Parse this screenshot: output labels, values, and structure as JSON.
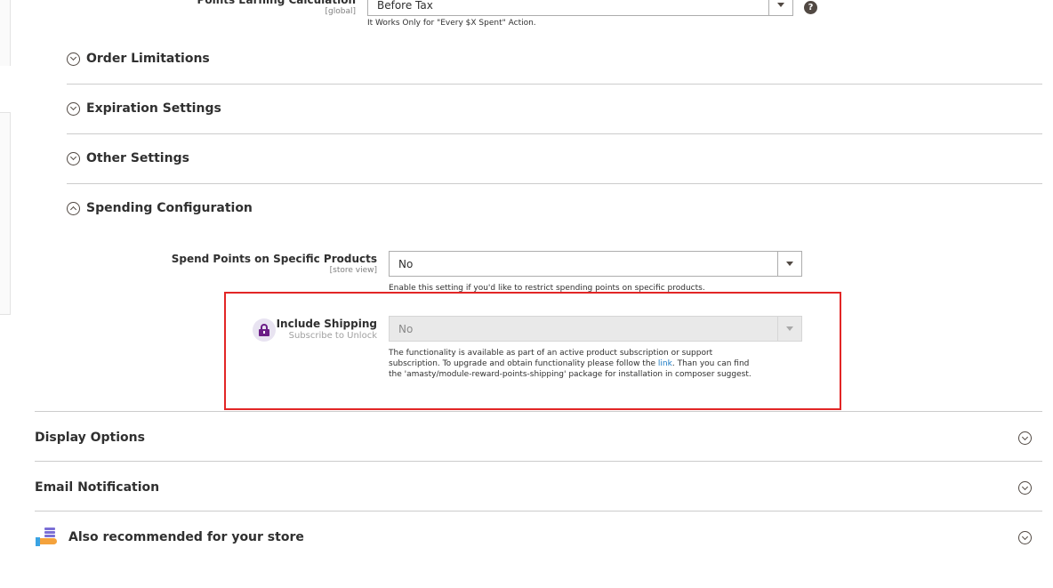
{
  "top_field": {
    "label": "Points Earning Calculation",
    "scope": "[global]",
    "value": "Before Tax",
    "note": "It Works Only for \"Every $X Spent\" Action.",
    "help_glyph": "?"
  },
  "subsections": {
    "order_limitations": "Order Limitations",
    "expiration_settings": "Expiration Settings",
    "other_settings": "Other Settings",
    "spending_configuration": "Spending Configuration"
  },
  "spend_specific": {
    "label": "Spend Points on Specific Products",
    "scope": "[store view]",
    "value": "No",
    "note": "Enable this setting if you'd like to restrict spending points on specific products."
  },
  "include_shipping": {
    "label": "Include Shipping",
    "sublabel": "Subscribe to Unlock",
    "value": "No",
    "note_line1": "The functionality is available as part of an active product subscription or support",
    "note_line2_before": "subscription. To upgrade and obtain functionality please follow the ",
    "note_link": "link",
    "note_line2_after": ". Than you can find",
    "note_line3": "the 'amasty/module-reward-points-shipping' package for installation in composer suggest."
  },
  "sections": {
    "display_options": "Display Options",
    "email_notification": "Email Notification",
    "also_recommended": "Also recommended for your store"
  },
  "colors": {
    "highlight_box": "#e22626",
    "lock_icon": "#6b1e86",
    "link": "#1979c3"
  }
}
